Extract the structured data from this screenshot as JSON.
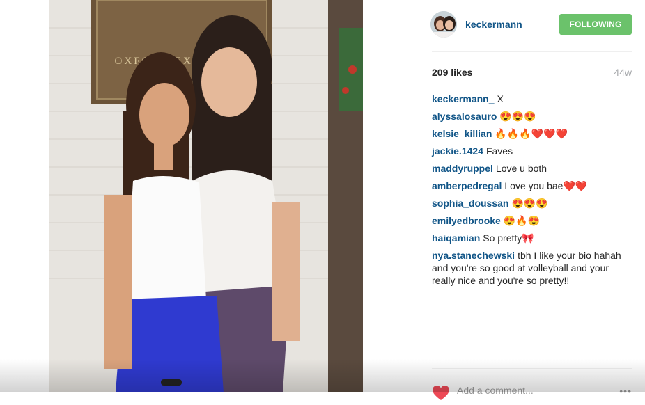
{
  "post": {
    "author": "keckermann_",
    "follow_label": "FOLLOWING",
    "likes": "209 likes",
    "age": "44w",
    "sign_text": "OXFORD EXCHANGE",
    "comments": [
      {
        "user": "keckermann_",
        "text": "X"
      },
      {
        "user": "alyssalosauro",
        "text": "😍😍😍"
      },
      {
        "user": "kelsie_killian",
        "text": "🔥🔥🔥❤️❤️❤️"
      },
      {
        "user": "jackie.1424",
        "text": "Faves"
      },
      {
        "user": "maddyruppel",
        "text": "Love u both"
      },
      {
        "user": "amberpedregal",
        "text": "Love you bae❤️❤️"
      },
      {
        "user": "sophia_doussan",
        "text": "😍😍😍"
      },
      {
        "user": "emilyedbrooke",
        "text": "😍🔥😍"
      },
      {
        "user": "haiqamian",
        "text": "So pretty🎀"
      },
      {
        "user": "nya.stanechewski",
        "text": "tbh I like your bio hahah and you're so good at volleyball and your really nice and you're so pretty!!"
      }
    ],
    "add_comment_placeholder": "Add a comment...",
    "more_label": "•••"
  },
  "colors": {
    "link": "#125688",
    "follow_bg": "#6bc26b",
    "heart": "#ed4956"
  },
  "icons": {
    "like": "heart-icon",
    "options": "more-options-icon"
  }
}
